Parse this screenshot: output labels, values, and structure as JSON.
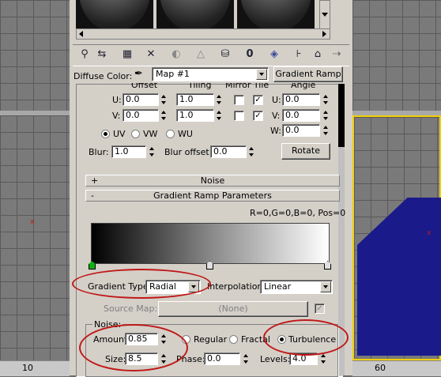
{
  "material_editor": {
    "diffuse_label": "Diffuse Color:",
    "map_name": "Map #1",
    "map_type_button": "Gradient Ramp"
  },
  "coordinates": {
    "col_offset": "Offset",
    "col_tiling": "Tiling",
    "col_mirror_tile": "Mirror Tile",
    "col_angle": "Angle",
    "u_label": "U:",
    "v_label": "V:",
    "w_label": "W:",
    "u_offset": "0.0",
    "v_offset": "0.0",
    "u_tiling": "1.0",
    "v_tiling": "1.0",
    "u_angle": "0.0",
    "v_angle": "0.0",
    "w_angle": "0.0",
    "radio_uv": "UV",
    "radio_vw": "VW",
    "radio_wu": "WU",
    "blur_label": "Blur:",
    "blur_value": "1.0",
    "blur_offset_label": "Blur offset:",
    "blur_offset_value": "0.0",
    "rotate_button": "Rotate"
  },
  "rollouts": {
    "noise": "Noise",
    "noise_sign": "+",
    "gradient": "Gradient Ramp Parameters",
    "gradient_sign": "-"
  },
  "gradient": {
    "readout": "R=0,G=0,B=0, Pos=0",
    "gradient_type_label": "Gradient Type:",
    "gradient_type_value": "Radial",
    "interpolation_label": "Interpolation:",
    "interpolation_value": "Linear",
    "source_map_label": "Source Map:",
    "source_map_value": "(None)"
  },
  "noise": {
    "group_label": "Noise:",
    "amount_label": "Amount:",
    "amount_value": "0.85",
    "size_label": "Size:",
    "size_value": "8.5",
    "phase_label": "Phase:",
    "phase_value": "0.0",
    "levels_label": "Levels:",
    "levels_value": "4.0",
    "radio_regular": "Regular",
    "radio_fractal": "Fractal",
    "radio_turbulence": "Turbulence"
  },
  "viewport": {
    "ruler_left": "10",
    "ruler_right": "60"
  },
  "colors": {
    "panel_bg": "#d4d0c8",
    "blue_object": "#1a1a8a",
    "viewport_active": "#f0d000",
    "annotation_red": "#c01818"
  }
}
